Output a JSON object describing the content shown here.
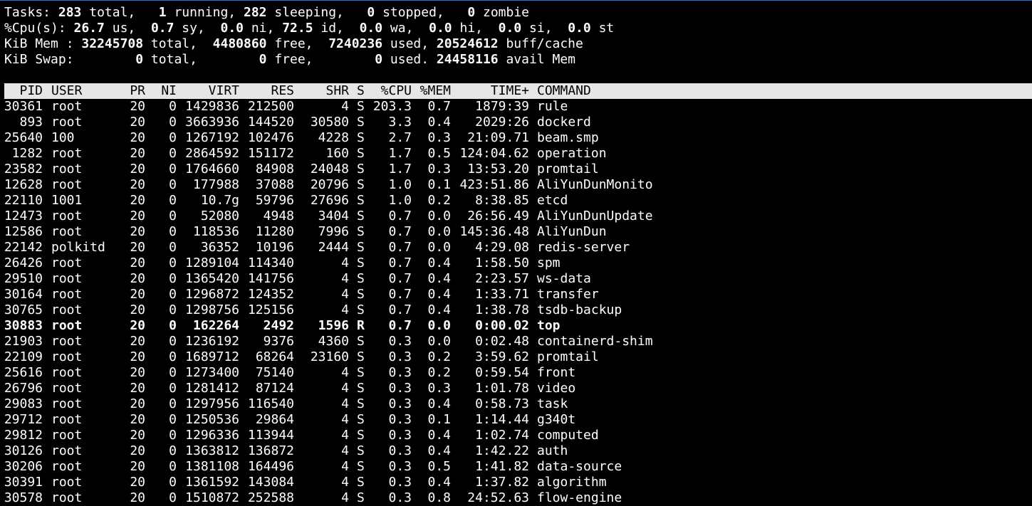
{
  "summary": {
    "tasks": {
      "label": "Tasks:",
      "total": "283",
      "total_label": " total,",
      "running": "1",
      "running_label": " running,",
      "sleeping": "282",
      "sleeping_label": " sleeping,",
      "stopped": "0",
      "stopped_label": " stopped,",
      "zombie": "0",
      "zombie_label": " zombie"
    },
    "cpu": {
      "label": "%Cpu(s):",
      "us": "26.7",
      "sy": "0.7",
      "ni": "0.0",
      "id": "72.5",
      "wa": "0.0",
      "hi": "0.0",
      "si": "0.0",
      "st": "0.0"
    },
    "mem": {
      "label": "KiB Mem :",
      "total": "32245708",
      "free": "4480860",
      "used": "7240236",
      "buff_cache": "20524612"
    },
    "swap": {
      "label": "KiB Swap:",
      "total": "0",
      "free": "0",
      "used": "0",
      "avail_mem": "24458116"
    }
  },
  "columns": [
    "PID",
    "USER",
    "PR",
    "NI",
    "VIRT",
    "RES",
    "SHR",
    "S",
    "%CPU",
    "%MEM",
    "TIME+",
    "COMMAND"
  ],
  "processes": [
    {
      "pid": "30361",
      "user": "root",
      "pr": "20",
      "ni": "0",
      "virt": "1429836",
      "res": "212500",
      "shr": "4",
      "s": "S",
      "cpu": "203.3",
      "mem": "0.7",
      "time": "1879:39",
      "command": "rule"
    },
    {
      "pid": "893",
      "user": "root",
      "pr": "20",
      "ni": "0",
      "virt": "3663936",
      "res": "144520",
      "shr": "30580",
      "s": "S",
      "cpu": "3.3",
      "mem": "0.4",
      "time": "2029:26",
      "command": "dockerd"
    },
    {
      "pid": "25640",
      "user": "100",
      "pr": "20",
      "ni": "0",
      "virt": "1267192",
      "res": "102476",
      "shr": "4228",
      "s": "S",
      "cpu": "2.7",
      "mem": "0.3",
      "time": "21:09.71",
      "command": "beam.smp"
    },
    {
      "pid": "1282",
      "user": "root",
      "pr": "20",
      "ni": "0",
      "virt": "2864592",
      "res": "151172",
      "shr": "160",
      "s": "S",
      "cpu": "1.7",
      "mem": "0.5",
      "time": "124:04.62",
      "command": "operation"
    },
    {
      "pid": "23582",
      "user": "root",
      "pr": "20",
      "ni": "0",
      "virt": "1764660",
      "res": "84908",
      "shr": "24048",
      "s": "S",
      "cpu": "1.7",
      "mem": "0.3",
      "time": "13:53.20",
      "command": "promtail"
    },
    {
      "pid": "12628",
      "user": "root",
      "pr": "20",
      "ni": "0",
      "virt": "177988",
      "res": "37088",
      "shr": "20796",
      "s": "S",
      "cpu": "1.0",
      "mem": "0.1",
      "time": "423:51.86",
      "command": "AliYunDunMonito"
    },
    {
      "pid": "22110",
      "user": "1001",
      "pr": "20",
      "ni": "0",
      "virt": "10.7g",
      "res": "59796",
      "shr": "27696",
      "s": "S",
      "cpu": "1.0",
      "mem": "0.2",
      "time": "8:38.85",
      "command": "etcd"
    },
    {
      "pid": "12473",
      "user": "root",
      "pr": "20",
      "ni": "0",
      "virt": "52080",
      "res": "4948",
      "shr": "3404",
      "s": "S",
      "cpu": "0.7",
      "mem": "0.0",
      "time": "26:56.49",
      "command": "AliYunDunUpdate"
    },
    {
      "pid": "12586",
      "user": "root",
      "pr": "20",
      "ni": "0",
      "virt": "118536",
      "res": "11280",
      "shr": "7996",
      "s": "S",
      "cpu": "0.7",
      "mem": "0.0",
      "time": "145:36.48",
      "command": "AliYunDun"
    },
    {
      "pid": "22142",
      "user": "polkitd",
      "pr": "20",
      "ni": "0",
      "virt": "36352",
      "res": "10196",
      "shr": "2444",
      "s": "S",
      "cpu": "0.7",
      "mem": "0.0",
      "time": "4:29.08",
      "command": "redis-server"
    },
    {
      "pid": "26426",
      "user": "root",
      "pr": "20",
      "ni": "0",
      "virt": "1289104",
      "res": "114340",
      "shr": "4",
      "s": "S",
      "cpu": "0.7",
      "mem": "0.4",
      "time": "1:58.50",
      "command": "spm"
    },
    {
      "pid": "29510",
      "user": "root",
      "pr": "20",
      "ni": "0",
      "virt": "1365420",
      "res": "141756",
      "shr": "4",
      "s": "S",
      "cpu": "0.7",
      "mem": "0.4",
      "time": "2:23.57",
      "command": "ws-data"
    },
    {
      "pid": "30164",
      "user": "root",
      "pr": "20",
      "ni": "0",
      "virt": "1296872",
      "res": "124352",
      "shr": "4",
      "s": "S",
      "cpu": "0.7",
      "mem": "0.4",
      "time": "1:33.71",
      "command": "transfer"
    },
    {
      "pid": "30765",
      "user": "root",
      "pr": "20",
      "ni": "0",
      "virt": "1298756",
      "res": "125156",
      "shr": "4",
      "s": "S",
      "cpu": "0.7",
      "mem": "0.4",
      "time": "1:38.78",
      "command": "tsdb-backup"
    },
    {
      "pid": "30883",
      "user": "root",
      "pr": "20",
      "ni": "0",
      "virt": "162264",
      "res": "2492",
      "shr": "1596",
      "s": "R",
      "cpu": "0.7",
      "mem": "0.0",
      "time": "0:00.02",
      "command": "top",
      "bold": true
    },
    {
      "pid": "21903",
      "user": "root",
      "pr": "20",
      "ni": "0",
      "virt": "1236192",
      "res": "9376",
      "shr": "4360",
      "s": "S",
      "cpu": "0.3",
      "mem": "0.0",
      "time": "0:02.48",
      "command": "containerd-shim"
    },
    {
      "pid": "22109",
      "user": "root",
      "pr": "20",
      "ni": "0",
      "virt": "1689712",
      "res": "68264",
      "shr": "23160",
      "s": "S",
      "cpu": "0.3",
      "mem": "0.2",
      "time": "3:59.62",
      "command": "promtail"
    },
    {
      "pid": "25616",
      "user": "root",
      "pr": "20",
      "ni": "0",
      "virt": "1273400",
      "res": "75140",
      "shr": "4",
      "s": "S",
      "cpu": "0.3",
      "mem": "0.2",
      "time": "0:59.54",
      "command": "front"
    },
    {
      "pid": "26796",
      "user": "root",
      "pr": "20",
      "ni": "0",
      "virt": "1281412",
      "res": "87124",
      "shr": "4",
      "s": "S",
      "cpu": "0.3",
      "mem": "0.3",
      "time": "1:01.78",
      "command": "video"
    },
    {
      "pid": "29083",
      "user": "root",
      "pr": "20",
      "ni": "0",
      "virt": "1297956",
      "res": "116540",
      "shr": "4",
      "s": "S",
      "cpu": "0.3",
      "mem": "0.4",
      "time": "0:58.73",
      "command": "task"
    },
    {
      "pid": "29712",
      "user": "root",
      "pr": "20",
      "ni": "0",
      "virt": "1250536",
      "res": "29864",
      "shr": "4",
      "s": "S",
      "cpu": "0.3",
      "mem": "0.1",
      "time": "1:14.44",
      "command": "g340t"
    },
    {
      "pid": "29812",
      "user": "root",
      "pr": "20",
      "ni": "0",
      "virt": "1296336",
      "res": "113944",
      "shr": "4",
      "s": "S",
      "cpu": "0.3",
      "mem": "0.4",
      "time": "1:02.74",
      "command": "computed"
    },
    {
      "pid": "30126",
      "user": "root",
      "pr": "20",
      "ni": "0",
      "virt": "1363812",
      "res": "136872",
      "shr": "4",
      "s": "S",
      "cpu": "0.3",
      "mem": "0.4",
      "time": "1:42.22",
      "command": "auth"
    },
    {
      "pid": "30206",
      "user": "root",
      "pr": "20",
      "ni": "0",
      "virt": "1381108",
      "res": "164496",
      "shr": "4",
      "s": "S",
      "cpu": "0.3",
      "mem": "0.5",
      "time": "1:41.82",
      "command": "data-source"
    },
    {
      "pid": "30391",
      "user": "root",
      "pr": "20",
      "ni": "0",
      "virt": "1361592",
      "res": "143084",
      "shr": "4",
      "s": "S",
      "cpu": "0.3",
      "mem": "0.4",
      "time": "1:37.82",
      "command": "algorithm"
    },
    {
      "pid": "30578",
      "user": "root",
      "pr": "20",
      "ni": "0",
      "virt": "1510872",
      "res": "252588",
      "shr": "4",
      "s": "S",
      "cpu": "0.3",
      "mem": "0.8",
      "time": "24:52.63",
      "command": "flow-engine"
    }
  ]
}
